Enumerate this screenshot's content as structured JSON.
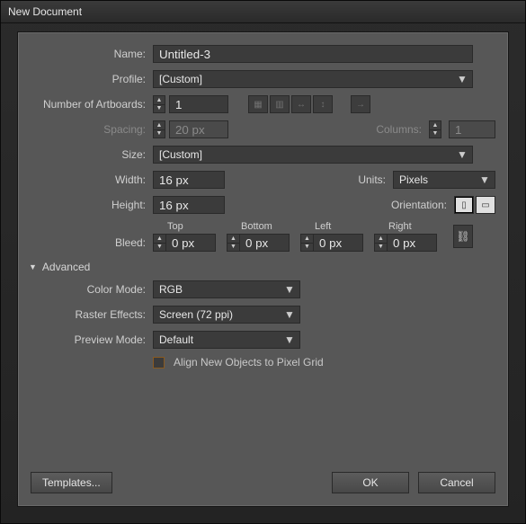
{
  "window": {
    "title": "New Document"
  },
  "labels": {
    "name": "Name:",
    "profile": "Profile:",
    "artboards": "Number of Artboards:",
    "spacing": "Spacing:",
    "columns": "Columns:",
    "size": "Size:",
    "width": "Width:",
    "height": "Height:",
    "units": "Units:",
    "orientation": "Orientation:",
    "bleed": "Bleed:",
    "bleedTop": "Top",
    "bleedBottom": "Bottom",
    "bleedLeft": "Left",
    "bleedRight": "Right",
    "advanced": "Advanced",
    "colorMode": "Color Mode:",
    "rasterEffects": "Raster Effects:",
    "previewMode": "Preview Mode:",
    "alignPixel": "Align New Objects to Pixel Grid"
  },
  "values": {
    "name": "Untitled-3",
    "profile": "[Custom]",
    "artboards": "1",
    "spacing": "20 px",
    "columns": "1",
    "size": "[Custom]",
    "width": "16 px",
    "height": "16 px",
    "units": "Pixels",
    "bleedTop": "0 px",
    "bleedBottom": "0 px",
    "bleedLeft": "0 px",
    "bleedRight": "0 px",
    "colorMode": "RGB",
    "rasterEffects": "Screen (72 ppi)",
    "previewMode": "Default"
  },
  "buttons": {
    "templates": "Templates...",
    "ok": "OK",
    "cancel": "Cancel"
  },
  "icons": {
    "caret": "▼",
    "triDown": "▼",
    "up": "▲",
    "down": "▼",
    "gridByRow": "▦",
    "gridByCol": "▥",
    "arrangeH": "↔",
    "arrangeV": "↕",
    "arrow": "→",
    "portrait": "▯",
    "landscape": "▭",
    "link": "⛓"
  }
}
